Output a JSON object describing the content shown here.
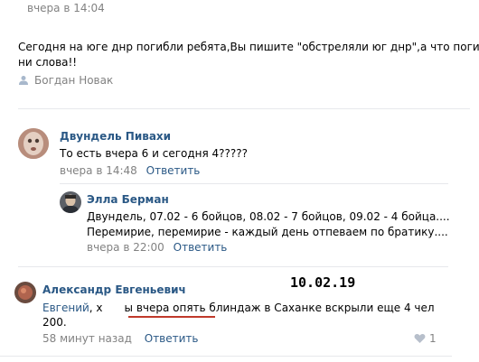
{
  "post": {
    "time": "вчера в 14:04",
    "text_line1": "Сегодня на юге днр погибли ребята,Вы пишите \"обстреляли юг днр\",а что погибли",
    "text_line2": "ни слова!!",
    "author": "Богдан Новак"
  },
  "comments": [
    {
      "name": "Двундель Пивахи",
      "text": "То есть вчера 6 и сегодня 4?????",
      "time": "вчера в 14:48",
      "reply_label": "Ответить"
    },
    {
      "name": "Элла Берман",
      "text_line1": "Двундель, 07.02 - 6 бойцов, 08.02 - 7 бойцов, 09.02 - 4 бойца....",
      "text_line2": "Перемирие, перемирие - каждый день отпеваем по братику....",
      "time": "вчера в 22:00",
      "reply_label": "Ответить"
    },
    {
      "name": "Александр Евгеньевич",
      "mention": "Евгений",
      "text_mid": ", х",
      "text_rest": "ы вчера опять блиндаж в Саханке вскрыли еще 4 чел",
      "text_line2": "200.",
      "time": "58 минут назад",
      "reply_label": "Ответить",
      "like_count": "1"
    }
  ],
  "annotation": {
    "date": "10.02.19",
    "underline_color": "#c0392b"
  }
}
